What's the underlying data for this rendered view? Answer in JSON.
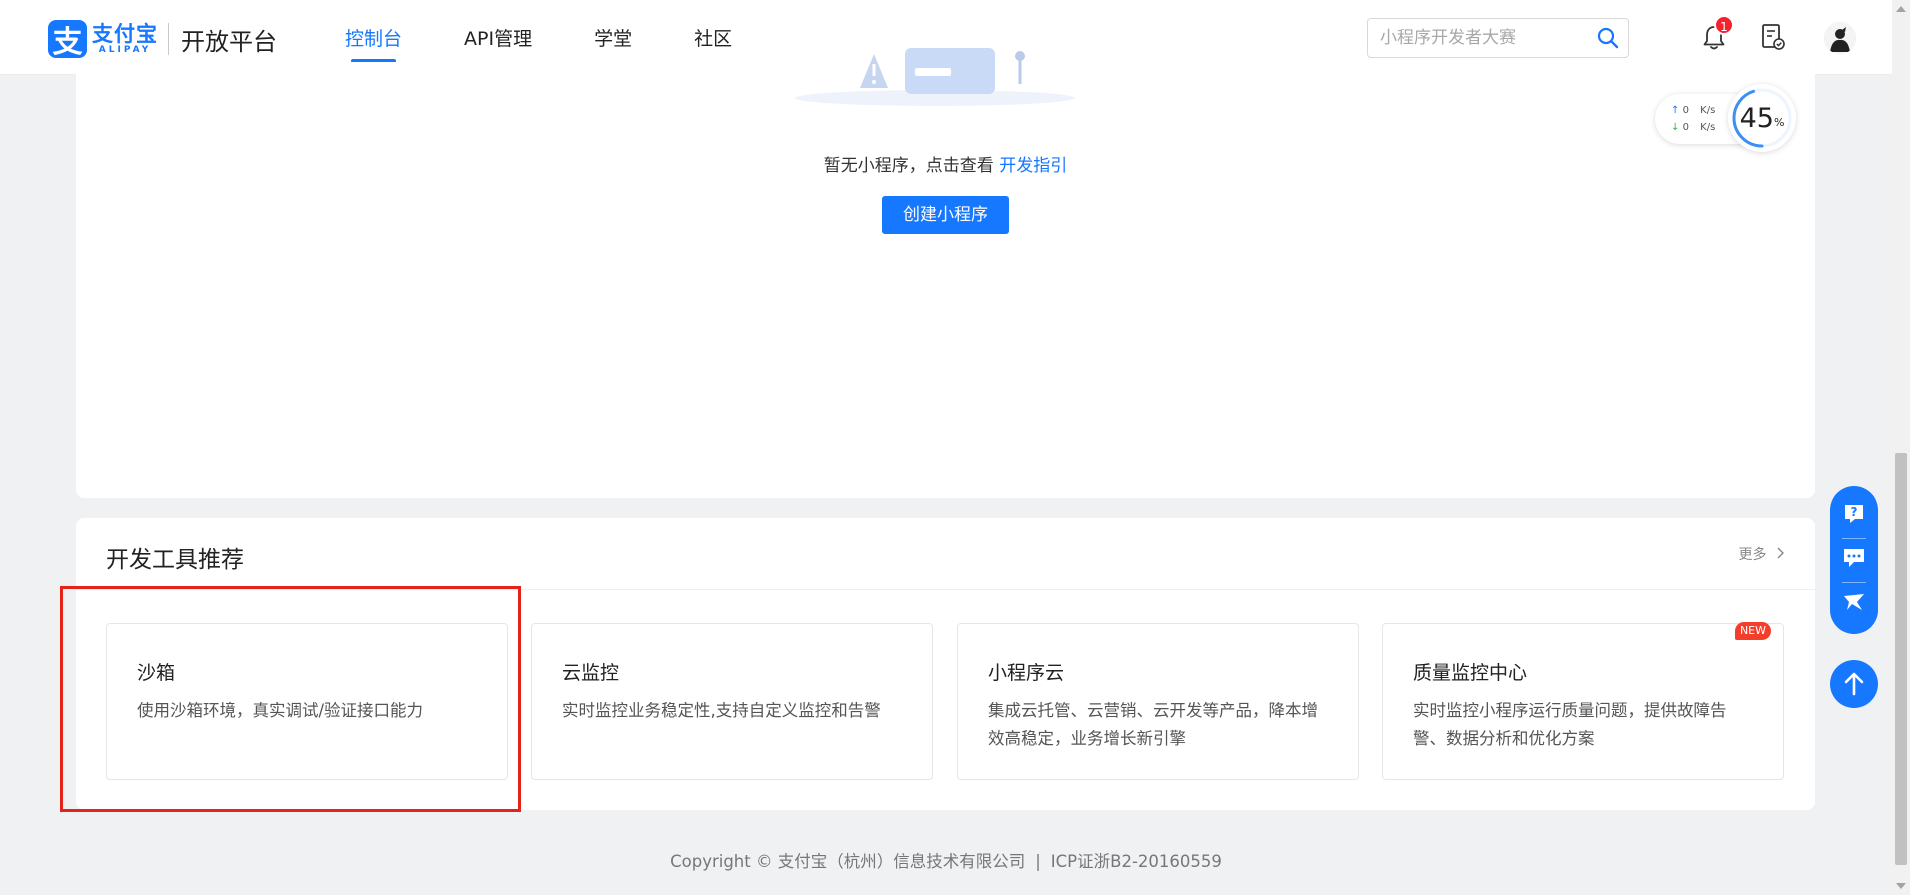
{
  "header": {
    "logo_cn": "支付宝",
    "logo_en": "ALIPAY",
    "platform": "开放平台",
    "nav": [
      {
        "label": "控制台",
        "active": true
      },
      {
        "label": "API管理",
        "active": false
      },
      {
        "label": "学堂",
        "active": false
      },
      {
        "label": "社区",
        "active": false
      }
    ],
    "search_placeholder": "小程序开发者大赛",
    "notification_count": "1"
  },
  "empty_state": {
    "text": "暂无小程序，点击查看 ",
    "link": "开发指引",
    "button": "创建小程序"
  },
  "speed_widget": {
    "up": "0",
    "down": "0",
    "unit": "K/s",
    "percent": "45",
    "percent_sign": "%",
    "percent_value": 0.45
  },
  "tools": {
    "title": "开发工具推荐",
    "more": "更多",
    "items": [
      {
        "title": "沙箱",
        "desc": "使用沙箱环境，真实调试/验证接口能力"
      },
      {
        "title": "云监控",
        "desc": "实时监控业务稳定性,支持自定义监控和告警"
      },
      {
        "title": "小程序云",
        "desc": "集成云托管、云营销、云开发等产品，降本增效高稳定，业务增长新引擎"
      },
      {
        "title": "质量监控中心",
        "desc": "实时监控小程序运行质量问题，提供故障告警、数据分析和优化方案",
        "tag": "NEW"
      }
    ]
  },
  "footer": {
    "copyright": "Copyright © 支付宝（杭州）信息技术有限公司",
    "separator": "|",
    "icp": "ICP证浙B2-20160559"
  },
  "colors": {
    "primary": "#1677ff",
    "highlight": "#e4231b",
    "new_tag": "#f53d2b"
  }
}
